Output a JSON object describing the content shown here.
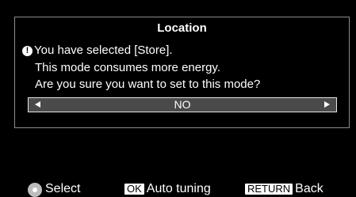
{
  "dialog": {
    "title": "Location",
    "warning_icon": "exclamation-circle-icon",
    "message_lines": [
      "You have selected [Store].",
      "This mode consumes more energy.",
      "Are you sure you want to set to this mode?"
    ],
    "selector": {
      "value": "NO",
      "left_arrow_icon": "arrow-left-icon",
      "right_arrow_icon": "arrow-right-icon"
    }
  },
  "footer": {
    "select": {
      "icon": "dpad-icon",
      "label": "Select"
    },
    "ok": {
      "key": "OK",
      "label": "Auto tuning"
    },
    "return": {
      "key": "RETURN",
      "label": "Back"
    }
  },
  "colors": {
    "background": "#000000",
    "text": "#ffffff",
    "dialog_border": "#8c8c8c",
    "selector_fill": "#4a4a4a",
    "key_badge": "#ffffff"
  }
}
